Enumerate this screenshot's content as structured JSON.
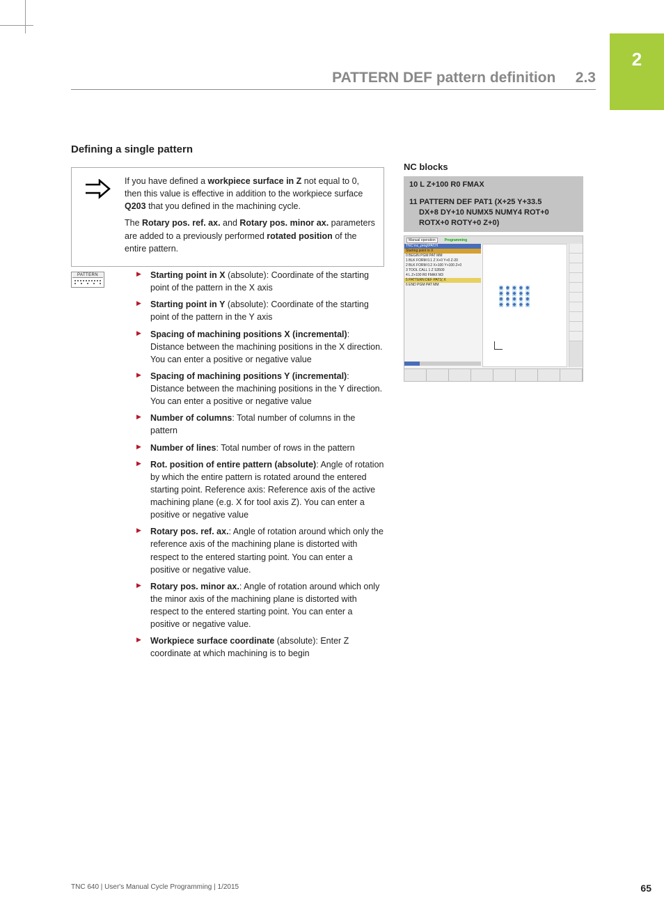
{
  "tab": "2",
  "header": {
    "title": "PATTERN DEF pattern definition",
    "num": "2.3"
  },
  "section_title": "Defining a single pattern",
  "info": {
    "p1_pre": "If you have defined a ",
    "p1_b1": "workpiece surface in Z",
    "p1_mid": " not equal to 0, then this value is effective in addition to the workpiece surface ",
    "p1_b2": "Q203",
    "p1_post": " that you defined in the machining cycle.",
    "p2_pre": "The ",
    "p2_b1": "Rotary pos. ref. ax.",
    "p2_mid": " and ",
    "p2_b2": "Rotary pos. minor ax.",
    "p2_mid2": " parameters are added to a previously performed ",
    "p2_b3": "rotated position",
    "p2_post": " of the entire pattern."
  },
  "params": [
    {
      "b": "Starting point in X",
      "t": " (absolute): Coordinate of the starting point of the pattern in the X axis"
    },
    {
      "b": "Starting point in Y",
      "t": " (absolute): Coordinate of the starting point of the pattern in the Y axis"
    },
    {
      "b": "Spacing of machining positions X (incremental)",
      "t": ": Distance between the machining positions in the X direction. You can enter a positive or negative value"
    },
    {
      "b": "Spacing of machining positions Y (incremental)",
      "t": ": Distance between the machining positions in the Y direction. You can enter a positive or negative value"
    },
    {
      "b": "Number of columns",
      "t": ": Total number of columns in the pattern"
    },
    {
      "b": "Number of lines",
      "t": ": Total number of rows in the pattern"
    },
    {
      "b": "Rot. position of entire pattern (absolute)",
      "t": ": Angle of rotation by which the entire pattern is rotated around the entered starting point. Reference axis: Reference axis of the active machining plane (e.g. X for tool axis Z). You can enter a positive or negative value"
    },
    {
      "b": "Rotary pos. ref. ax.",
      "t": ": Angle of rotation around which only the reference axis of the machining plane is distorted with respect to the entered starting point. You can enter a positive or negative value."
    },
    {
      "b": "Rotary pos. minor ax.",
      "t": ": Angle of rotation around which only the minor axis of the machining plane is distorted with respect to the entered starting point. You can enter a positive or negative value."
    },
    {
      "b": "Workpiece surface coordinate",
      "t": " (absolute): Enter Z coordinate at which machining is to begin"
    }
  ],
  "nc": {
    "title": "NC blocks",
    "l1": "10 L Z+100 R0 FMAX",
    "l2a": "11 PATTERN DEF PAT1 (X+25 Y+33.5",
    "l2b": "DX+8 DY+10 NUMX5 NUMY4 ROT+0",
    "l2c": "ROTX+0 ROTY+0 Z+0)"
  },
  "ss": {
    "mode": "Manual operation",
    "prog": "Programming",
    "lines": [
      {
        "cls": "blue",
        "t": "TNC:\\nc_prog\\PAT.H"
      },
      {
        "cls": "gold",
        "t": "Starting point in X"
      },
      {
        "cls": "",
        "t": "0 BEGIN PGM PAT MM"
      },
      {
        "cls": "",
        "t": "1 BLK FORM 0.1 Z X+0 Y+0 Z-20"
      },
      {
        "cls": "",
        "t": "2 BLK FORM 0.2 X+100 Y+100 Z+0"
      },
      {
        "cls": "",
        "t": "3 TOOL CALL 1 Z S3500"
      },
      {
        "cls": "",
        "t": "4 L Z+100 R0 FMAX M3"
      },
      {
        "cls": "yellow",
        "t": "5 PATTERN DEF PAT1( X"
      },
      {
        "cls": "",
        "t": "6 END PGM PAT MM"
      }
    ]
  },
  "pattern_icon_label": "PATTERN",
  "footer": "TNC 640 | User's Manual Cycle Programming | 1/2015",
  "page": "65"
}
